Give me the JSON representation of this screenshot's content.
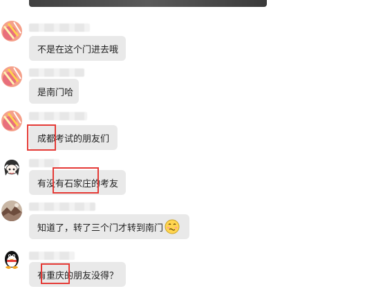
{
  "chat": {
    "messages": [
      {
        "text": "不是在这个门进去哦",
        "avatar_icon": "food-photo-avatar-icon"
      },
      {
        "text": "是南门哈",
        "avatar_icon": "food-photo-avatar-icon"
      },
      {
        "text": "成都考试的朋友们",
        "avatar_icon": "food-photo-avatar-icon"
      },
      {
        "text": "有没有石家庄的考友",
        "avatar_icon": "anime-girl-avatar-icon"
      },
      {
        "text": "知道了，转了三个门才转到南门",
        "avatar_icon": "landscape-photo-avatar-icon",
        "emoji_icon": "embarrassed-face-emoji-icon"
      },
      {
        "text": "有重庆的朋友没得？",
        "avatar_icon": "qq-penguin-avatar-icon"
      }
    ]
  },
  "colors": {
    "bubble": "#e9e9e9",
    "highlight": "#e53935",
    "text": "#1f1f1f"
  }
}
